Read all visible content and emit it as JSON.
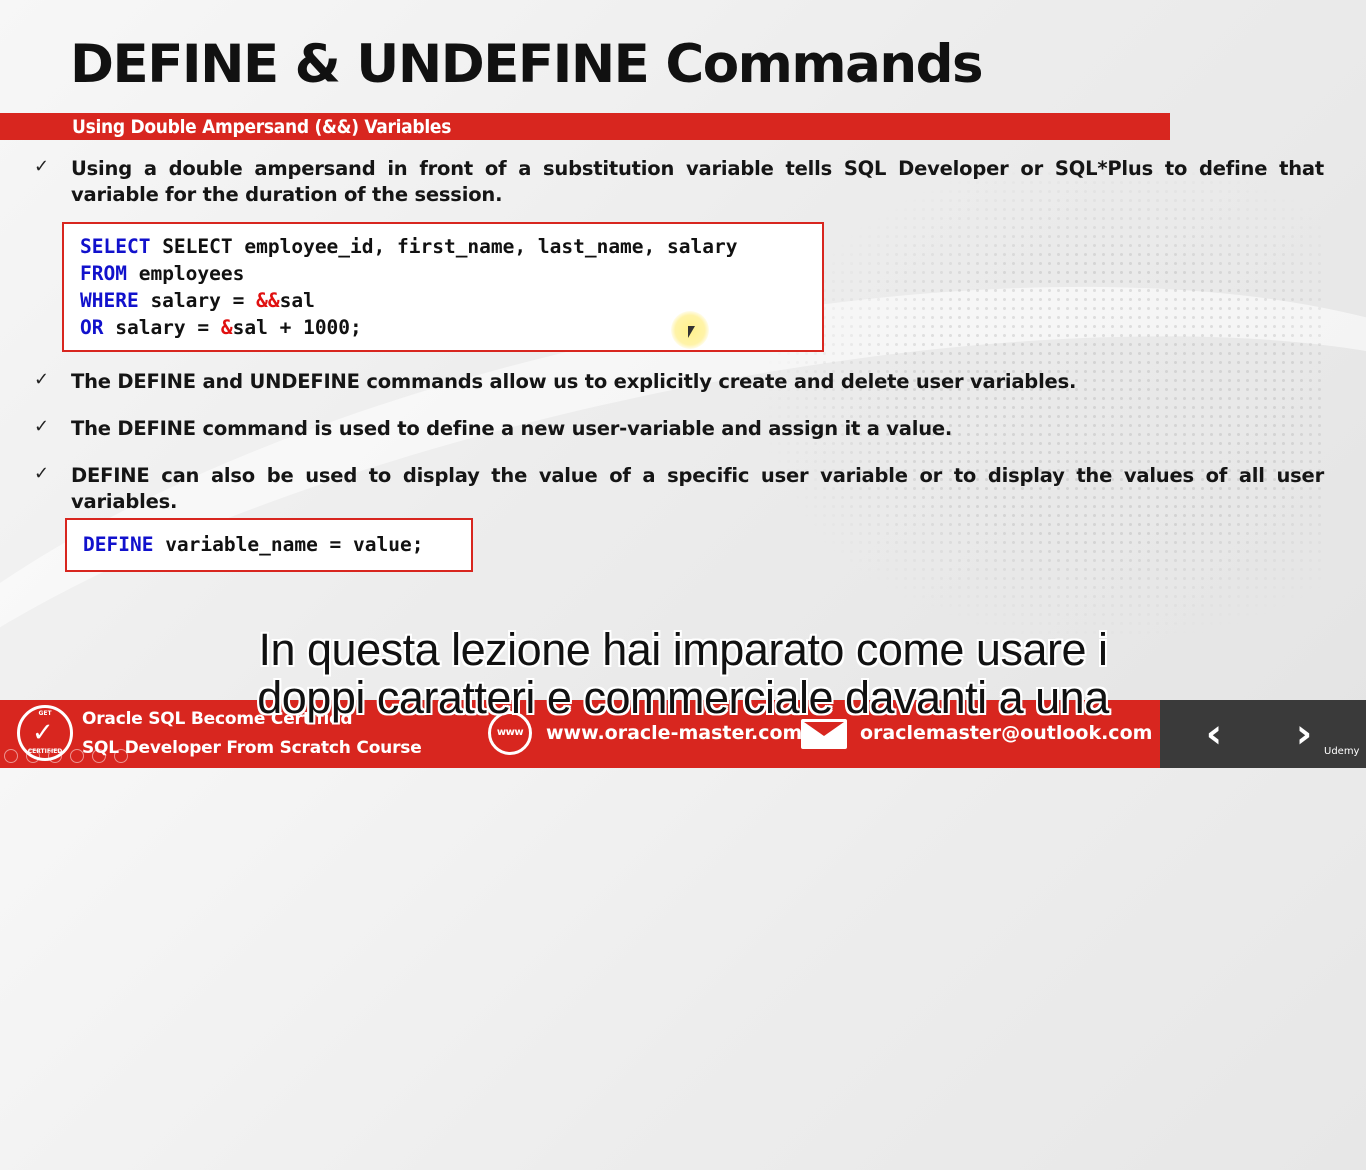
{
  "slide": {
    "title": "DEFINE & UNDEFINE Commands",
    "subtitle": "Using Double Ampersand (&&) Variables",
    "bullets": [
      "Using a double ampersand in front of a substitution variable tells SQL Developer or SQL*Plus to define that variable for the duration of the session.",
      "The DEFINE and UNDEFINE commands allow us to explicitly create and delete user variables.",
      "The DEFINE command is used to define a new user-variable and assign it a value.",
      "DEFINE can also be used to display the value of a specific user variable or to display the values of all user variables."
    ],
    "check_glyph": "✓",
    "code1": {
      "line1_kw": "SELECT",
      "line1_rest": " SELECT employee_id, first_name, last_name, salary",
      "line2_kw": "FROM",
      "line2_rest": " employees",
      "line3_kw": "WHERE",
      "line3_mid": " salary = ",
      "line3_amp": "&&",
      "line3_rest": "sal",
      "line4_kw": "OR",
      "line4_mid": " salary = ",
      "line4_amp": "&",
      "line4_rest": "sal + 1000;"
    },
    "code2": {
      "kw": "DEFINE",
      "rest": " variable_name = value;"
    },
    "colors": {
      "accent_red": "#d8261f",
      "keyword_blue": "#1111cc",
      "amp_red": "#e01010"
    }
  },
  "subtitles": {
    "line1": "In questa lezione hai imparato come usare i",
    "line2": "doppi caratteri e commerciale davanti a una"
  },
  "footer": {
    "badge_top": "GET",
    "badge_bottom": "CERTIFIED",
    "course_line1": "Oracle SQL Become Certified",
    "course_line2": "SQL Developer From Scratch Course",
    "www_label": "www",
    "website": "www.oracle-master.com",
    "email": "oraclemaster@outlook.com",
    "prev_icon": "chevron-left-icon",
    "next_icon": "chevron-right-icon",
    "brand": "Udemy"
  }
}
